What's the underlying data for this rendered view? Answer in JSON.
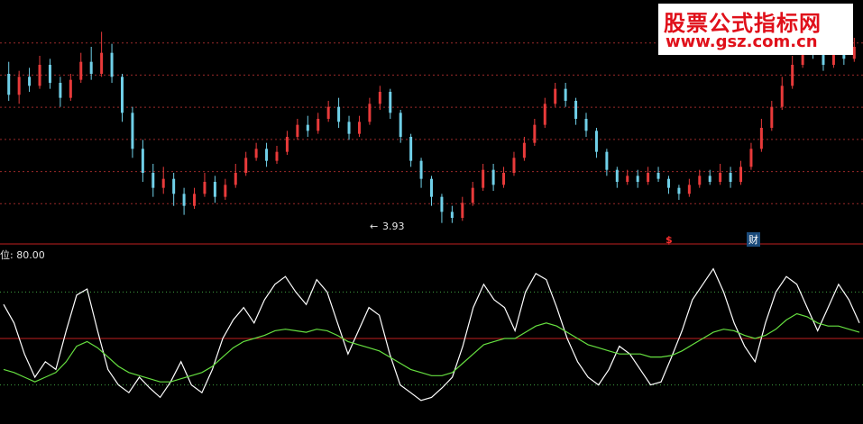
{
  "watermark": {
    "title": "股票公式指标网",
    "url": "www.gsz.com.cn"
  },
  "price_panel": {
    "low_label": "3.93",
    "low_arrow": "←"
  },
  "markers": {
    "dollar": "$",
    "cai": "财"
  },
  "indicator_panel": {
    "level_label": "位: 80.00"
  },
  "colors": {
    "background": "#000000",
    "up_candle": "#e83a3a",
    "down_candle": "#70d0e8",
    "grid": "#9a2a2a",
    "separator": "#c02020",
    "fast_line": "#ffffff",
    "slow_line": "#66e040",
    "dotted_level": "#40a040"
  },
  "chart_data": [
    {
      "type": "candlestick",
      "series": [
        {
          "name": "",
          "values": [
            [
              8.9,
              8.2,
              9.3,
              8.0
            ],
            [
              8.2,
              8.8,
              9.0,
              7.9
            ],
            [
              8.8,
              8.5,
              9.1,
              8.3
            ],
            [
              8.5,
              9.2,
              9.5,
              8.4
            ],
            [
              9.2,
              8.6,
              9.4,
              8.4
            ],
            [
              8.6,
              8.1,
              8.8,
              7.8
            ],
            [
              8.1,
              8.7,
              8.9,
              8.0
            ],
            [
              8.7,
              9.3,
              9.6,
              8.6
            ],
            [
              9.3,
              8.9,
              9.8,
              8.7
            ],
            [
              8.9,
              9.6,
              10.3,
              8.8
            ],
            [
              9.6,
              8.8,
              9.9,
              8.6
            ],
            [
              8.8,
              7.6,
              8.9,
              7.3
            ],
            [
              7.6,
              6.4,
              7.8,
              6.1
            ],
            [
              6.4,
              5.6,
              6.7,
              5.3
            ],
            [
              5.6,
              5.1,
              5.9,
              4.8
            ],
            [
              5.1,
              5.4,
              5.8,
              4.9
            ],
            [
              5.4,
              4.9,
              5.6,
              4.5
            ],
            [
              4.9,
              4.5,
              5.1,
              4.2
            ],
            [
              4.5,
              4.9,
              5.1,
              4.4
            ],
            [
              4.9,
              5.3,
              5.6,
              4.8
            ],
            [
              5.3,
              4.8,
              5.5,
              4.6
            ],
            [
              4.8,
              5.2,
              5.4,
              4.7
            ],
            [
              5.2,
              5.6,
              5.9,
              5.1
            ],
            [
              5.6,
              6.1,
              6.3,
              5.5
            ],
            [
              6.1,
              6.4,
              6.6,
              6.0
            ],
            [
              6.4,
              6.0,
              6.6,
              5.8
            ],
            [
              6.0,
              6.3,
              6.5,
              5.9
            ],
            [
              6.3,
              6.8,
              7.0,
              6.2
            ],
            [
              6.8,
              7.2,
              7.4,
              6.7
            ],
            [
              7.2,
              7.0,
              7.5,
              6.8
            ],
            [
              7.0,
              7.4,
              7.6,
              6.9
            ],
            [
              7.4,
              7.8,
              8.0,
              7.3
            ],
            [
              7.8,
              7.3,
              8.1,
              7.1
            ],
            [
              7.3,
              6.9,
              7.5,
              6.7
            ],
            [
              6.9,
              7.3,
              7.5,
              6.8
            ],
            [
              7.3,
              7.9,
              8.1,
              7.2
            ],
            [
              7.9,
              8.3,
              8.5,
              7.7
            ],
            [
              8.3,
              7.6,
              8.4,
              7.4
            ],
            [
              7.6,
              6.8,
              7.7,
              6.6
            ],
            [
              6.8,
              6.0,
              6.9,
              5.8
            ],
            [
              6.0,
              5.4,
              6.1,
              5.1
            ],
            [
              5.4,
              4.8,
              5.5,
              4.5
            ],
            [
              4.8,
              4.3,
              4.9,
              3.93
            ],
            [
              4.3,
              4.1,
              4.5,
              3.93
            ],
            [
              4.1,
              4.6,
              4.8,
              4.0
            ],
            [
              4.6,
              5.1,
              5.3,
              4.5
            ],
            [
              5.1,
              5.7,
              5.9,
              5.0
            ],
            [
              5.7,
              5.2,
              5.9,
              5.0
            ],
            [
              5.2,
              5.6,
              5.8,
              5.1
            ],
            [
              5.6,
              6.1,
              6.3,
              5.5
            ],
            [
              6.1,
              6.6,
              6.8,
              6.0
            ],
            [
              6.6,
              7.2,
              7.4,
              6.5
            ],
            [
              7.2,
              7.9,
              8.1,
              7.1
            ],
            [
              7.9,
              8.4,
              8.6,
              7.8
            ],
            [
              8.4,
              8.0,
              8.6,
              7.8
            ],
            [
              8.0,
              7.4,
              8.1,
              7.2
            ],
            [
              7.4,
              7.0,
              7.6,
              6.8
            ],
            [
              7.0,
              6.3,
              7.1,
              6.1
            ],
            [
              6.3,
              5.7,
              6.4,
              5.5
            ],
            [
              5.7,
              5.3,
              5.8,
              5.1
            ],
            [
              5.3,
              5.5,
              5.7,
              5.2
            ],
            [
              5.5,
              5.3,
              5.7,
              5.1
            ],
            [
              5.3,
              5.6,
              5.8,
              5.2
            ],
            [
              5.6,
              5.4,
              5.8,
              5.3
            ],
            [
              5.4,
              5.1,
              5.5,
              4.9
            ],
            [
              5.1,
              4.9,
              5.2,
              4.7
            ],
            [
              4.9,
              5.2,
              5.4,
              4.8
            ],
            [
              5.2,
              5.5,
              5.7,
              5.1
            ],
            [
              5.5,
              5.3,
              5.7,
              5.2
            ],
            [
              5.3,
              5.6,
              5.9,
              5.2
            ],
            [
              5.6,
              5.3,
              5.8,
              5.1
            ],
            [
              5.3,
              5.8,
              6.0,
              5.2
            ],
            [
              5.8,
              6.4,
              6.6,
              5.7
            ],
            [
              6.4,
              7.1,
              7.4,
              6.3
            ],
            [
              7.1,
              7.8,
              8.0,
              7.0
            ],
            [
              7.8,
              8.5,
              8.8,
              7.7
            ],
            [
              8.5,
              9.2,
              9.5,
              8.4
            ],
            [
              9.2,
              9.9,
              10.3,
              9.1
            ],
            [
              9.9,
              9.6,
              10.2,
              9.4
            ],
            [
              9.6,
              9.2,
              9.8,
              9.0
            ],
            [
              9.2,
              9.7,
              10.0,
              9.1
            ],
            [
              9.7,
              9.4,
              9.9,
              9.2
            ],
            [
              9.4,
              9.8,
              10.1,
              9.3
            ]
          ]
        }
      ],
      "low_marker": 3.93,
      "ylim": [
        3.5,
        11.0
      ],
      "grid": true
    },
    {
      "type": "line",
      "series": [
        {
          "name": "",
          "values": [
            72,
            60,
            40,
            25,
            35,
            30,
            55,
            78,
            82,
            55,
            30,
            20,
            15,
            25,
            18,
            12,
            22,
            35,
            20,
            15,
            30,
            50,
            62,
            70,
            60,
            75,
            85,
            90,
            80,
            72,
            88,
            80,
            60,
            40,
            55,
            70,
            65,
            40,
            20,
            15,
            10,
            12,
            18,
            25,
            45,
            70,
            85,
            75,
            70,
            55,
            80,
            92,
            88,
            70,
            50,
            35,
            25,
            20,
            30,
            45,
            40,
            30,
            20,
            22,
            38,
            55,
            75,
            85,
            95,
            80,
            60,
            45,
            35,
            60,
            80,
            90,
            85,
            70,
            55,
            70,
            85,
            75,
            60
          ]
        },
        {
          "name": "",
          "values": [
            30,
            28,
            25,
            22,
            25,
            28,
            35,
            45,
            48,
            44,
            38,
            32,
            28,
            26,
            24,
            22,
            22,
            24,
            26,
            28,
            32,
            38,
            44,
            48,
            50,
            52,
            55,
            56,
            55,
            54,
            56,
            55,
            52,
            48,
            46,
            44,
            42,
            38,
            34,
            30,
            28,
            26,
            26,
            28,
            34,
            40,
            46,
            48,
            50,
            50,
            54,
            58,
            60,
            58,
            54,
            50,
            46,
            44,
            42,
            40,
            40,
            40,
            38,
            38,
            39,
            42,
            46,
            50,
            54,
            56,
            55,
            52,
            50,
            52,
            56,
            62,
            66,
            64,
            60,
            58,
            58,
            56,
            54
          ]
        }
      ],
      "levels": [
        80,
        50,
        20
      ],
      "ylim": [
        0,
        100
      ],
      "grid": true
    }
  ]
}
